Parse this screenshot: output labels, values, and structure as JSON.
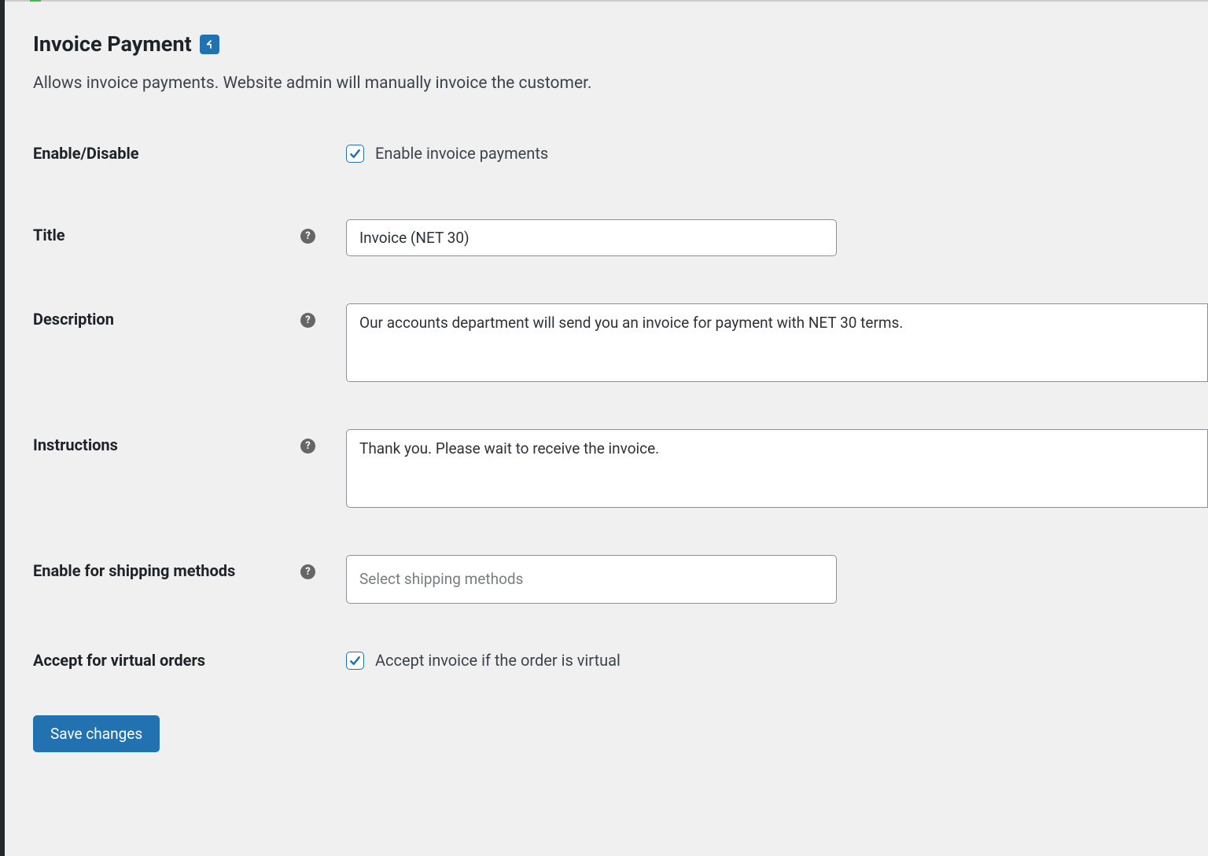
{
  "header": {
    "title": "Invoice Payment",
    "subtitle": "Allows invoice payments. Website admin will manually invoice the customer."
  },
  "form": {
    "enable": {
      "label": "Enable/Disable",
      "checkbox_label": "Enable invoice payments",
      "checked": true
    },
    "title": {
      "label": "Title",
      "value": "Invoice (NET 30)"
    },
    "description": {
      "label": "Description",
      "value": "Our accounts department will send you an invoice for payment with NET 30 terms."
    },
    "instructions": {
      "label": "Instructions",
      "value": "Thank you. Please wait to receive the invoice."
    },
    "shipping_methods": {
      "label": "Enable for shipping methods",
      "placeholder": "Select shipping methods"
    },
    "virtual_orders": {
      "label": "Accept for virtual orders",
      "checkbox_label": "Accept invoice if the order is virtual",
      "checked": true
    }
  },
  "actions": {
    "save_label": "Save changes"
  },
  "help_tooltip": "?"
}
